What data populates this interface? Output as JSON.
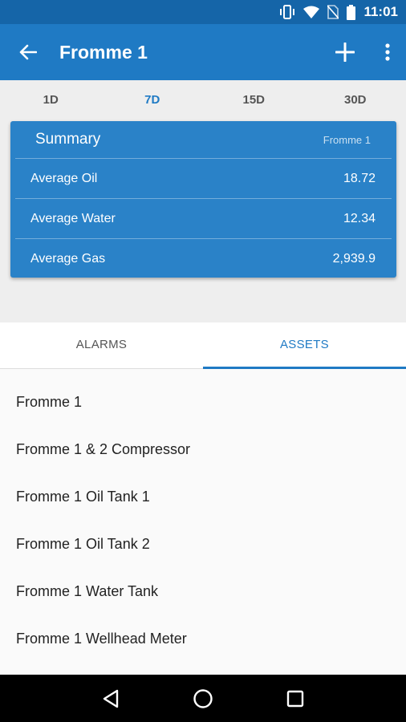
{
  "status_bar": {
    "time": "11:01",
    "icons": [
      "vibrate-icon",
      "wifi-icon",
      "no-sim-icon",
      "battery-icon"
    ]
  },
  "app_bar": {
    "title": "Fromme 1",
    "color": "#1f7ac4",
    "icons": [
      "arrow-back-icon",
      "plus-icon",
      "more-vert-icon"
    ]
  },
  "range_tabs": {
    "items": [
      "1D",
      "7D",
      "15D",
      "30D"
    ],
    "selected": "7D"
  },
  "summary": {
    "title": "Summary",
    "subtitle": "Fromme 1",
    "rows": [
      {
        "label": "Average Oil",
        "value": "18.72"
      },
      {
        "label": "Average Water",
        "value": "12.34"
      },
      {
        "label": "Average Gas",
        "value": "2,939.9"
      }
    ]
  },
  "main_tabs": {
    "items": [
      "ALARMS",
      "ASSETS"
    ],
    "selected": "ASSETS"
  },
  "assets": [
    "Fromme 1",
    "Fromme 1 & 2 Compressor",
    "Fromme 1 Oil Tank 1",
    "Fromme 1 Oil Tank 2",
    "Fromme 1 Water Tank",
    "Fromme 1 Wellhead Meter"
  ],
  "nav_bar": {
    "icons": [
      "back-triangle-icon",
      "home-circle-icon",
      "recents-square-icon"
    ]
  }
}
